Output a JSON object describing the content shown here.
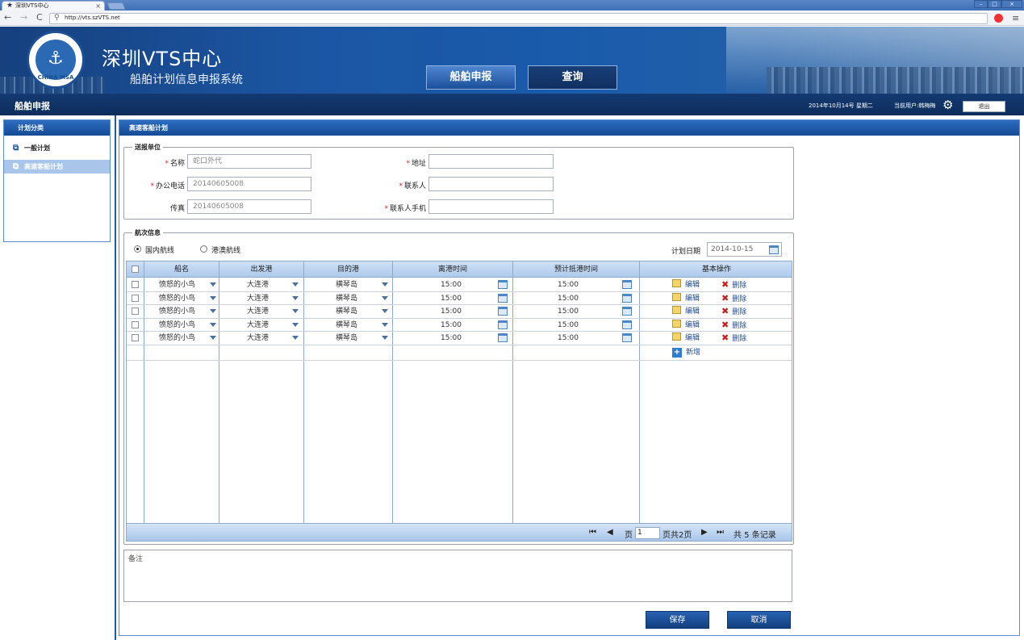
{
  "browser": {
    "tab_title": "深圳VTS中心",
    "url": "http://vts.szVTS.net",
    "controls": {
      "minimize": "–",
      "maximize": "▢",
      "close": "×",
      "tab_close": "×",
      "back": "←",
      "forward": "→",
      "reload": "C",
      "menu": "≡"
    }
  },
  "header": {
    "site_title": "深圳VTS中心",
    "site_subtitle": "船舶计划信息申报系统",
    "logo_text": "CHINA MSA",
    "nav": [
      {
        "label": "船舶申报"
      },
      {
        "label": "查询"
      }
    ]
  },
  "subbar": {
    "title": "船舶申报",
    "date": "2014年10月14号  星期二",
    "user": "当前用户:韩梅梅",
    "logout": "退出"
  },
  "sidebar": {
    "header": "计划分类",
    "items": [
      {
        "label": "一般计划"
      },
      {
        "label": "高速客船计划"
      }
    ]
  },
  "main": {
    "header": "高速客船计划",
    "unit": {
      "legend": "送报单位",
      "name_label": "名称",
      "name_value": "蛇口外代",
      "phone_label": "办公电话",
      "phone_value": "20140605008",
      "fax_label": "传真",
      "fax_value": "20140605008",
      "address_label": "地址",
      "address_value": "",
      "contact_label": "联系人",
      "contact_value": "",
      "mobile_label": "联系人手机",
      "mobile_value": "",
      "required_mark": "*"
    },
    "voyage": {
      "legend": "航次信息",
      "route_domestic": "国内航线",
      "route_hkmacau": "港澳航线",
      "plan_date_label": "计划日期",
      "plan_date": "2014-10-15",
      "columns": [
        "船名",
        "出发港",
        "目的港",
        "离港时间",
        "预计抵港时间",
        "基本操作"
      ],
      "rows": [
        {
          "ship": "愤怒的小鸟",
          "from": "大连港",
          "to": "横琴岛",
          "depart": "15:00",
          "arrive": "15:00"
        },
        {
          "ship": "愤怒的小鸟",
          "from": "大连港",
          "to": "横琴岛",
          "depart": "15:00",
          "arrive": "15:00"
        },
        {
          "ship": "愤怒的小鸟",
          "from": "大连港",
          "to": "横琴岛",
          "depart": "15:00",
          "arrive": "15:00"
        },
        {
          "ship": "愤怒的小鸟",
          "from": "大连港",
          "to": "横琴岛",
          "depart": "15:00",
          "arrive": "15:00"
        },
        {
          "ship": "愤怒的小鸟",
          "from": "大连港",
          "to": "横琴岛",
          "depart": "15:00",
          "arrive": "15:00"
        }
      ],
      "edit_label": "编辑",
      "delete_label": "删除",
      "add_label": "新增"
    },
    "pager": {
      "page_label": "页",
      "current_page": "1",
      "total_pages": "页共2页",
      "records": "共 5 条记录"
    },
    "remark_label": "备注",
    "save_label": "保存",
    "cancel_label": "取消"
  }
}
